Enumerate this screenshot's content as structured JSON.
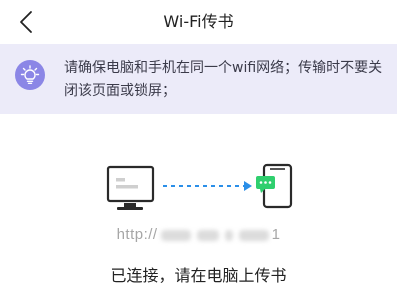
{
  "header": {
    "title": "Wi-Fi传书",
    "back_icon": "chevron-left-icon"
  },
  "notice": {
    "icon": "lightbulb-icon",
    "icon_bg": "#8b86e6",
    "bg": "#ecebf9",
    "text": "请确保电脑和手机在同一个wifi网络；传输时不要关闭该页面或锁屏；"
  },
  "transfer": {
    "computer_icon": "desktop-computer-icon",
    "phone_icon": "phone-message-icon",
    "arrow_icon": "dashed-arrow-right-icon",
    "accent": "#2b8fe8",
    "badge_color": "#2fcf6e"
  },
  "address": {
    "prefix": "http://",
    "suffix": "1"
  },
  "status": {
    "text": "已连接，请在电脑上传书"
  }
}
